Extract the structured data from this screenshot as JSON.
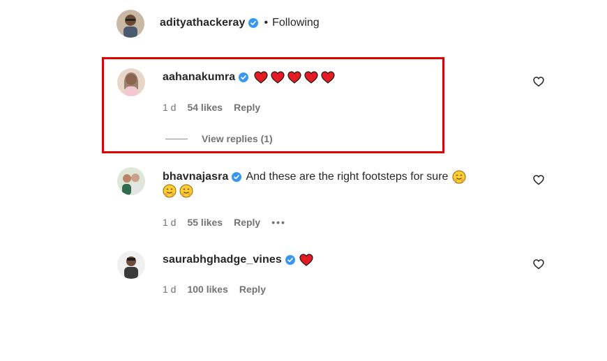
{
  "header_comment": {
    "username": "adityathackeray",
    "following_label": "Following"
  },
  "comments": [
    {
      "username": "aahanakumra",
      "emoji": "heart-emoji x5",
      "time": "1 d",
      "likes": "54 likes",
      "reply_label": "Reply",
      "view_replies_label": "View replies (1)"
    },
    {
      "username": "bhavnajasra",
      "text": "And these are the right footsteps for sure",
      "emoji": "hugging-face-emoji x3",
      "time": "1 d",
      "likes": "55 likes",
      "reply_label": "Reply",
      "more_label": "•••"
    },
    {
      "username": "saurabhghadge_vines",
      "emoji": "heart-emoji x1",
      "time": "1 d",
      "likes": "100 likes",
      "reply_label": "Reply"
    }
  ],
  "colors": {
    "verified": "#3897f0",
    "highlight_box": "#e00000",
    "heart_emoji": "#e31b23",
    "meta_text": "#737373"
  },
  "icons": {
    "verified": "verified-badge-icon",
    "like": "heart-outline-icon"
  }
}
